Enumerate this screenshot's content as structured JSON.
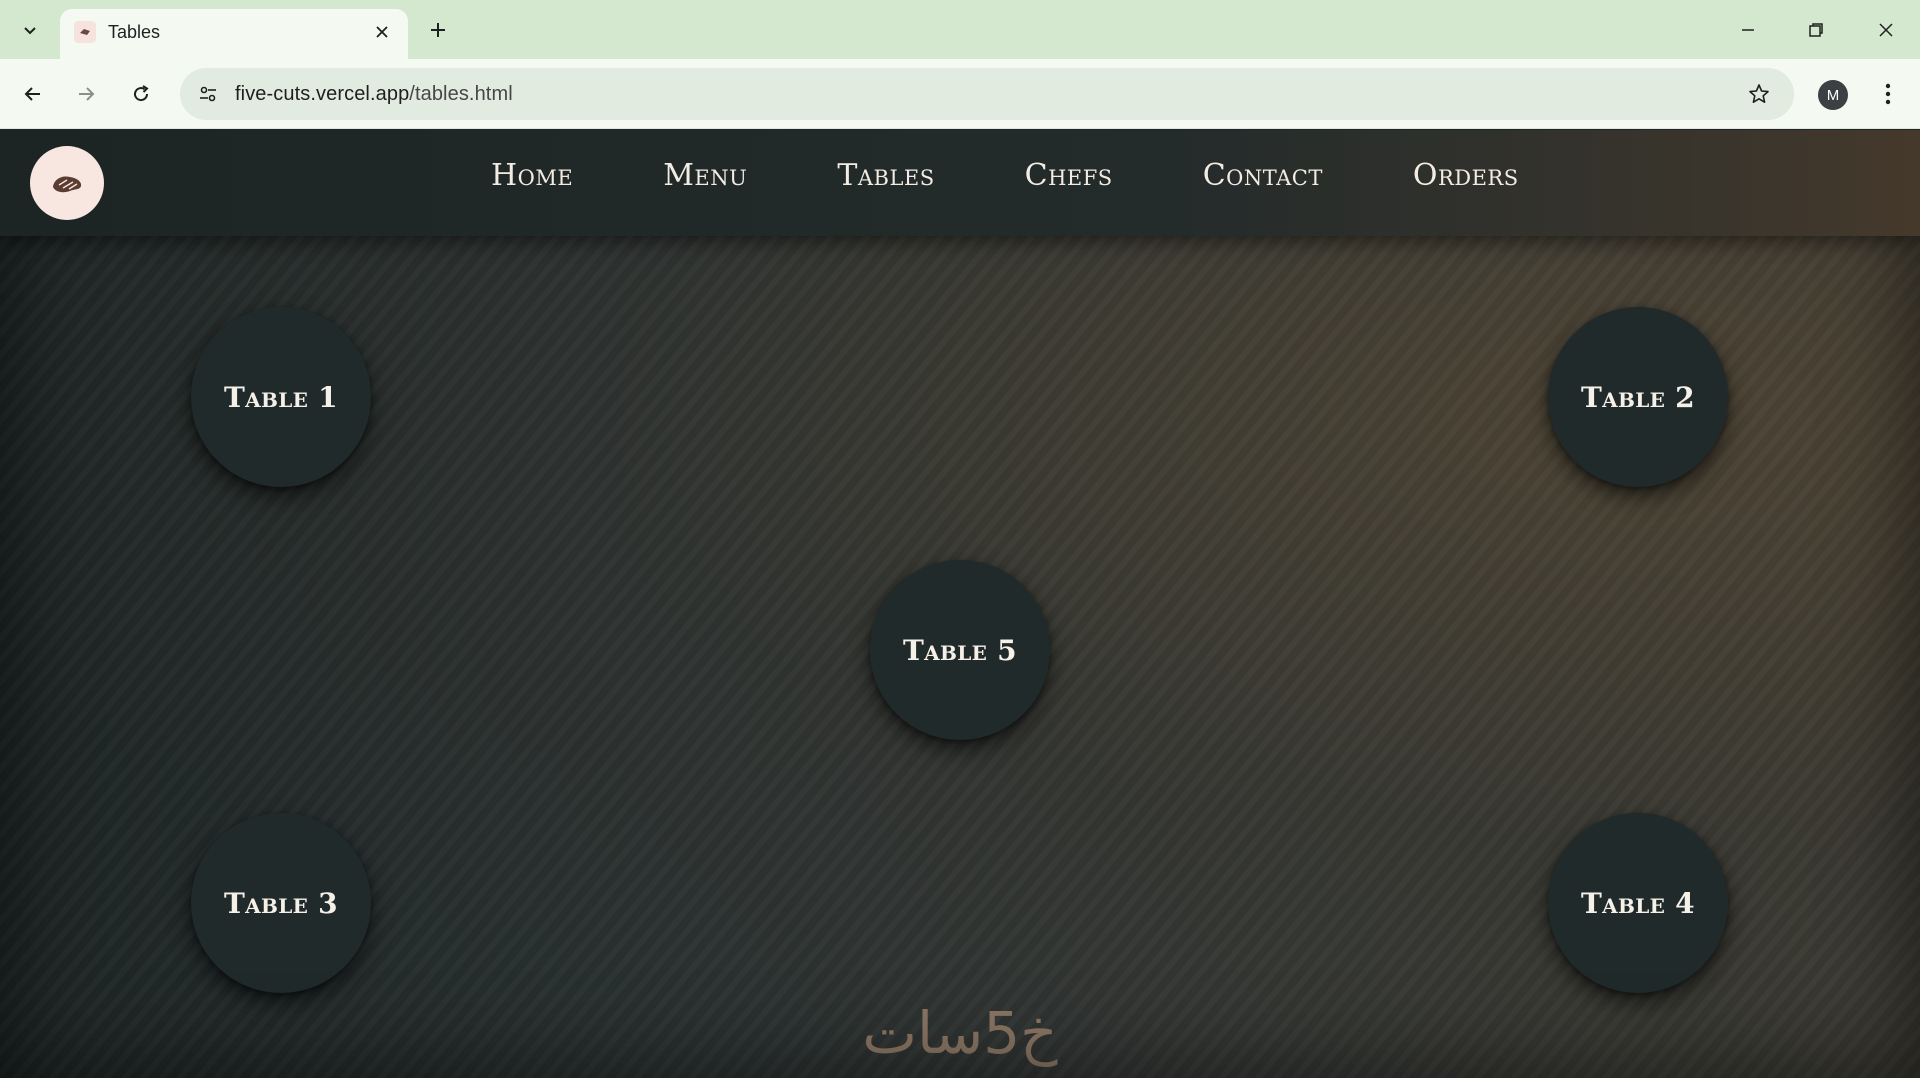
{
  "browser": {
    "tab": {
      "title": "Tables",
      "close_glyph": "✕"
    },
    "new_tab_glyph": "+",
    "url": {
      "host": "five-cuts.vercel.app",
      "path": "/tables.html"
    },
    "profile_initial": "M"
  },
  "site": {
    "logo_icon": "steak-icon",
    "nav": [
      {
        "label": "Home"
      },
      {
        "label": "Menu"
      },
      {
        "label": "Tables"
      },
      {
        "label": "Chefs"
      },
      {
        "label": "Contact"
      },
      {
        "label": "Orders"
      }
    ],
    "tables": [
      {
        "label": "Table 1"
      },
      {
        "label": "Table 2"
      },
      {
        "label": "Table 3"
      },
      {
        "label": "Table 4"
      },
      {
        "label": "Table 5"
      }
    ],
    "footer_mark": "خ5سات"
  },
  "colors": {
    "accent": "#8a7563",
    "header_bg": "#1c2424",
    "table_bg": "#212a2a",
    "logo_bg": "#f8e6e1"
  }
}
